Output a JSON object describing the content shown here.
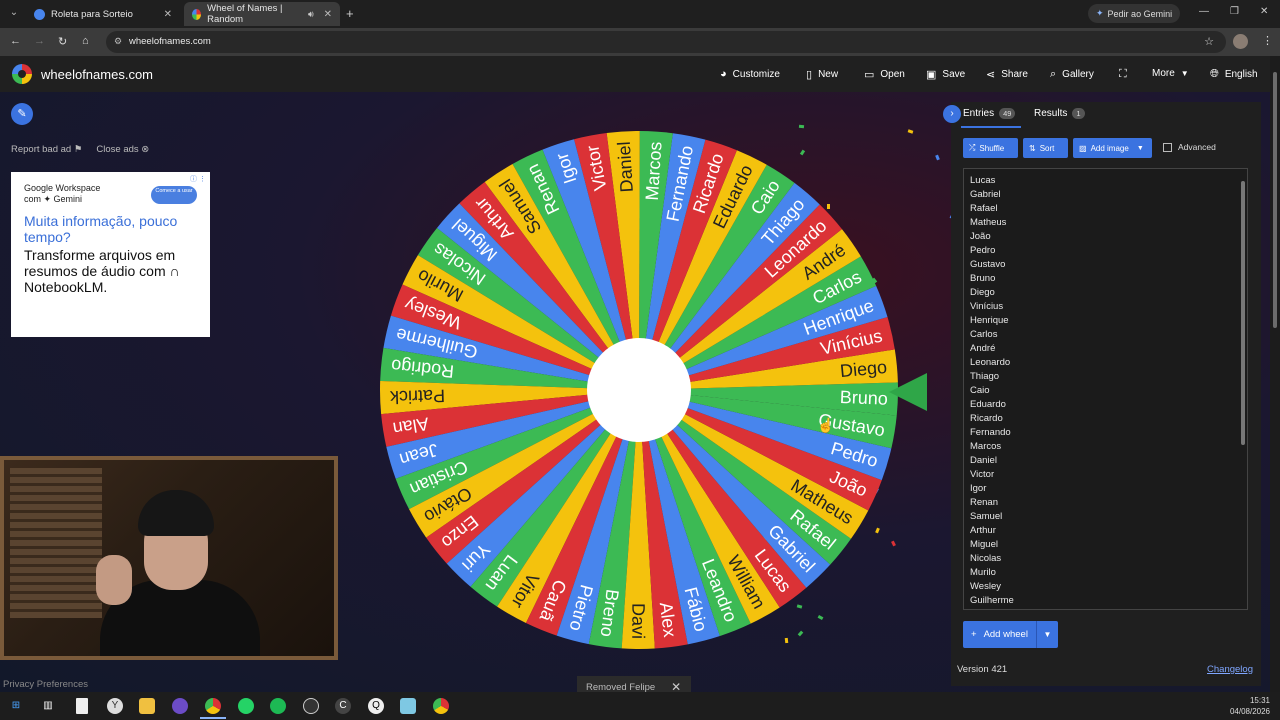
{
  "browser": {
    "tabs": [
      {
        "title": "Roleta para Sorteio",
        "active": false
      },
      {
        "title": "Wheel of Names | Random",
        "active": true
      }
    ],
    "gemini_button": "Pedir ao Gemini",
    "url": "wheelofnames.com"
  },
  "site": {
    "logo_text": "wheelofnames.com",
    "menu": [
      {
        "label": "Customize",
        "icon": "palette-icon"
      },
      {
        "label": "New",
        "icon": "file-icon"
      },
      {
        "label": "Open",
        "icon": "folder-icon"
      },
      {
        "label": "Save",
        "icon": "save-icon"
      },
      {
        "label": "Share",
        "icon": "share-icon"
      },
      {
        "label": "Gallery",
        "icon": "search-icon"
      },
      {
        "label": "",
        "icon": "fullscreen-icon"
      },
      {
        "label": "More",
        "icon": "chevron-down-icon"
      },
      {
        "label": "English",
        "icon": "globe-icon"
      }
    ]
  },
  "ads": {
    "report_bad_ad": "Report bad ad",
    "close_ads": "Close ads",
    "brand_line1": "Google Workspace",
    "brand_line2": "com ✦ Gemini",
    "cta": "Comece a usar",
    "headline_blue": "Muita informação, pouco tempo?",
    "headline_black": "Transforme arquivos em resumos de áudio com ∩ NotebookLM."
  },
  "privacy": "Privacy Preferences",
  "toast": "Removed Felipe",
  "wheel": {
    "colors": [
      "#db3236",
      "#4885ed",
      "#3cba54",
      "#f4c20d"
    ]
  },
  "panel": {
    "tab_entries": "Entries",
    "entries_count": "49",
    "tab_results": "Results",
    "results_count": "1",
    "shuffle": "Shuffle",
    "sort": "Sort",
    "add_image": "Add image",
    "advanced": "Advanced",
    "entries": [
      "Lucas",
      "Gabriel",
      "Rafael",
      "Matheus",
      "João",
      "Pedro",
      "Gustavo",
      "Bruno",
      "Diego",
      "Vinícius",
      "Henrique",
      "Carlos",
      "André",
      "Leonardo",
      "Thiago",
      "Caio",
      "Eduardo",
      "Ricardo",
      "Fernando",
      "Marcos",
      "Daniel",
      "Victor",
      "Igor",
      "Renan",
      "Samuel",
      "Arthur",
      "Miguel",
      "Nicolas",
      "Murilo",
      "Wesley",
      "Guilherme"
    ],
    "wheel_labels_ccw_from_pointer": [
      "Bruno",
      "Diego",
      "Vinícius",
      "Henrique",
      "Carlos",
      "André",
      "Leonardo",
      "Thiago",
      "Caio",
      "Eduardo",
      "Ricardo",
      "Fernando",
      "Marcos",
      "Daniel",
      "Victor",
      "Igor",
      "Renan",
      "Samuel",
      "Arthur",
      "Miguel",
      "Nicolas",
      "Murilo",
      "Wesley",
      "Guilherme",
      "Rodrigo",
      "Patrick",
      "Alan",
      "Jean",
      "Cristian",
      "Otávio",
      "Enzo",
      "Yuri",
      "Luan",
      "Vitor",
      "Cauã",
      "Pietro",
      "Breno",
      "Davi",
      "Alex",
      "Fábio",
      "Leandro",
      "William",
      "Lucas",
      "Gabriel",
      "Rafael",
      "Matheus",
      "João",
      "Pedro",
      "Gustavo"
    ],
    "add_wheel": "Add wheel",
    "version": "Version 421",
    "changelog": "Changelog"
  },
  "taskbar": {
    "time": "15:31",
    "date": "04/08/2026"
  }
}
